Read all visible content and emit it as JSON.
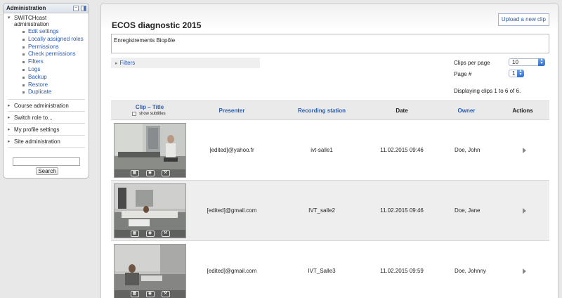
{
  "admin_block": {
    "title": "Administration",
    "collapse_glyph": "−",
    "tree_root": "SWITCHcast administration",
    "items": [
      {
        "label": "Edit settings"
      },
      {
        "label": "Locally assigned roles"
      },
      {
        "label": "Permissions"
      },
      {
        "label": "Check permissions"
      },
      {
        "label": "Filters"
      },
      {
        "label": "Logs"
      },
      {
        "label": "Backup"
      },
      {
        "label": "Restore"
      },
      {
        "label": "Duplicate"
      }
    ],
    "categories": [
      {
        "label": "Course administration"
      },
      {
        "label": "Switch role to..."
      },
      {
        "label": "My profile settings"
      },
      {
        "label": "Site administration"
      }
    ],
    "search_value": "",
    "search_button": "Search"
  },
  "page": {
    "title": "ECOS diagnostic 2015",
    "upload_button": "Upload a new clip",
    "description": "Enregistrements Biopôle",
    "filters_label": "Filters",
    "clips_per_page_label": "Clips per page",
    "clips_per_page_value": "10",
    "page_label": "Page #",
    "page_value": "1",
    "displaying": "Displaying clips 1 to 6 of 6."
  },
  "table": {
    "headers": {
      "clip_title": "Clip – Title",
      "show_subtitles": "show subtitles",
      "presenter": "Presenter",
      "recording_station": "Recording station",
      "date": "Date",
      "owner": "Owner",
      "actions": "Actions"
    },
    "rows": [
      {
        "presenter": "[edited]@yahoo.fr",
        "station": "ivt-salle1",
        "date": "11.02.2015 09:46",
        "owner": "Doe, John"
      },
      {
        "presenter": "[edited]@gmail.com",
        "station": "IVT_salle2",
        "date": "11.02.2015 09:46",
        "owner": "Doe, Jane"
      },
      {
        "presenter": "[edited]@gmail.com",
        "station": "IVT_Salle3",
        "date": "11.02.2015 09:59",
        "owner": "Doe, Johnny"
      }
    ]
  },
  "icons": {
    "expand": "▾",
    "collapse": "▸",
    "select_arrows": "▴▾",
    "thumb_buttons": [
      "film-icon",
      "zoom-icon",
      "wrench-icon"
    ]
  },
  "colors": {
    "link": "#2a5ab0",
    "row_alt": "#eeeeee",
    "header_bg": "#eaeaea"
  }
}
